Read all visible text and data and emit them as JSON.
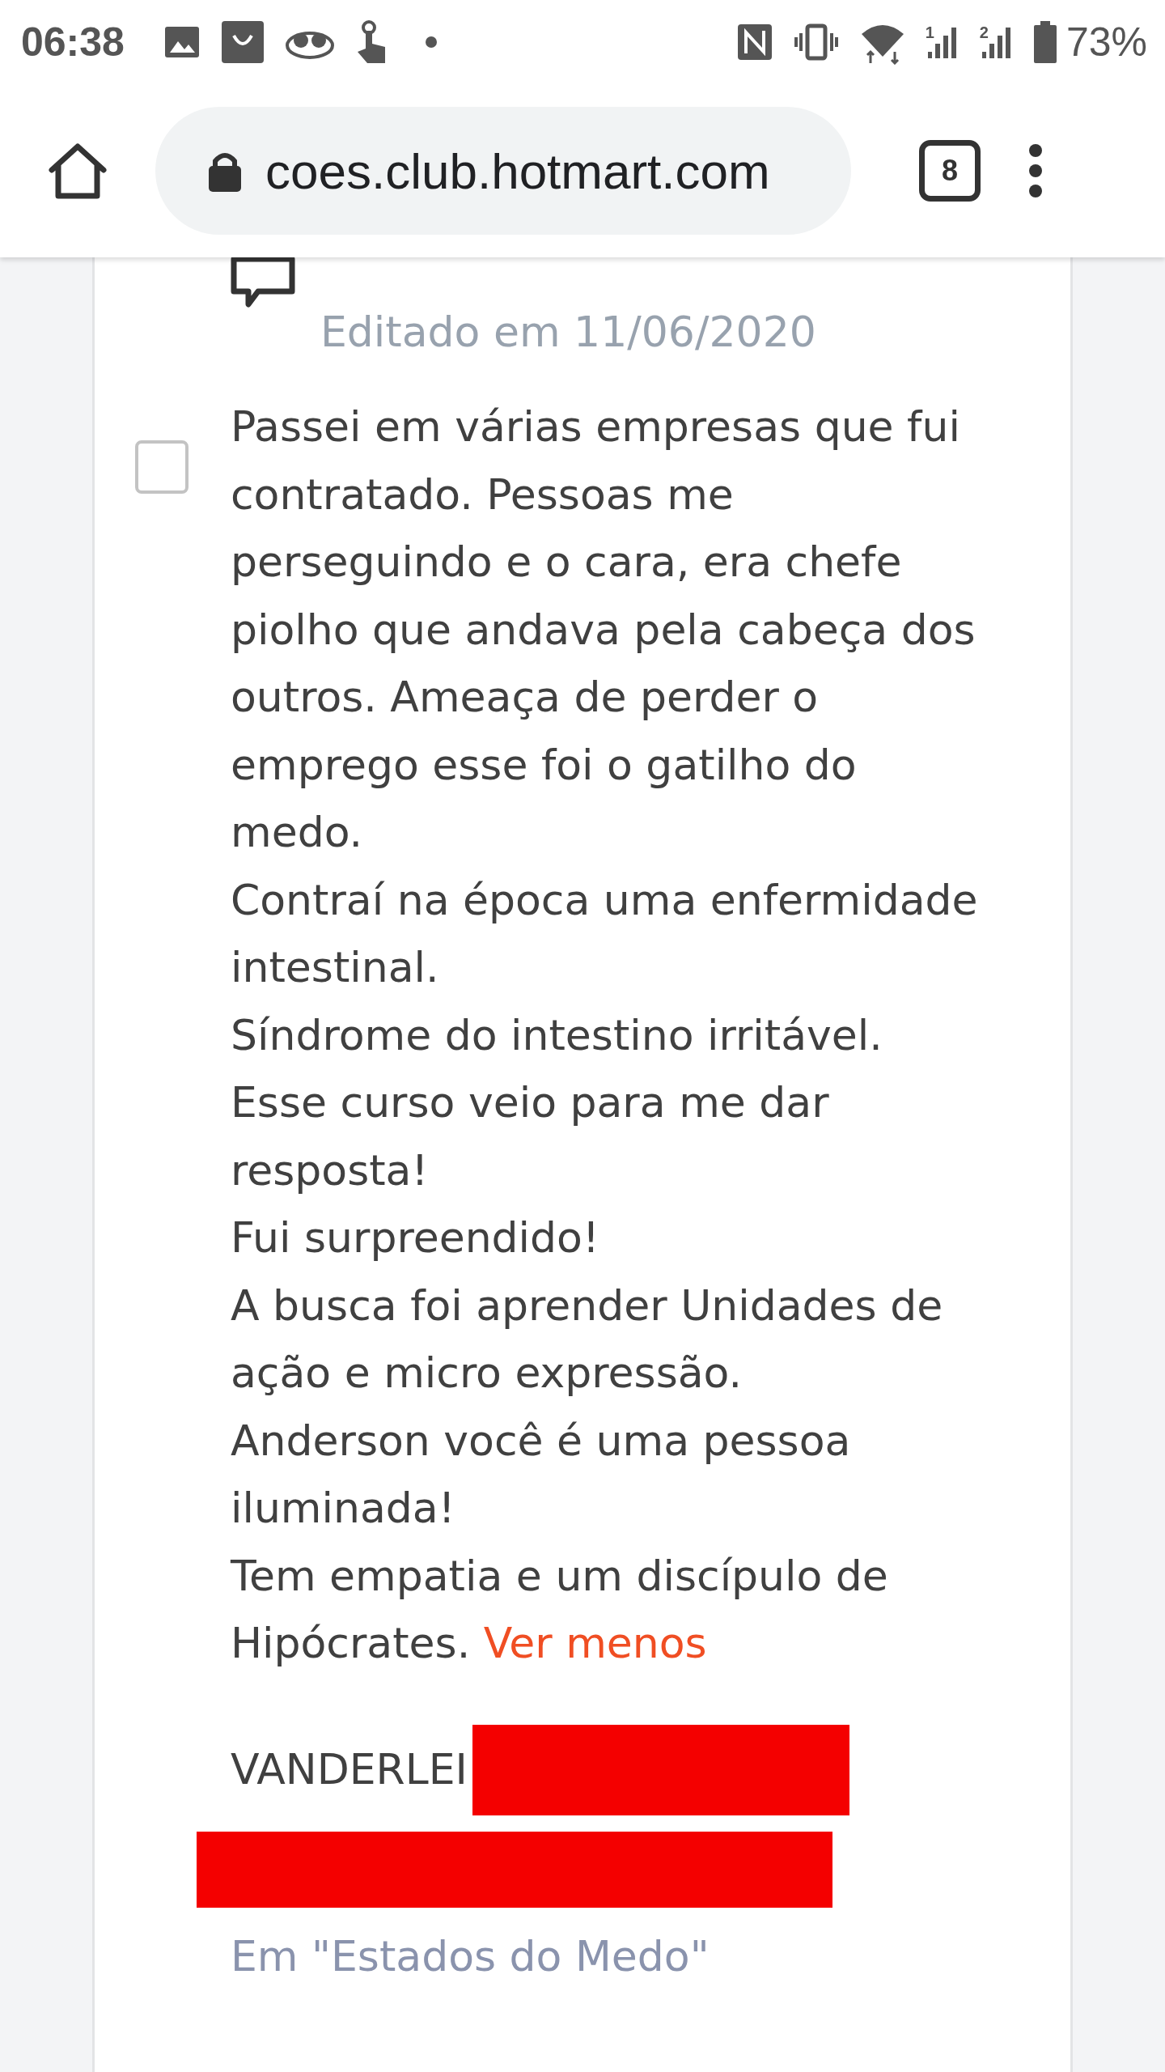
{
  "status_bar": {
    "time": "06:38",
    "battery": "73%",
    "sim_labels": [
      "1",
      "2"
    ]
  },
  "browser": {
    "url": "coes.club.hotmart.com",
    "tab_count": "8"
  },
  "post": {
    "edited": "Editado em 11/06/2020",
    "checked": false,
    "paragraphs": [
      "Passei em várias empresas que fui contratado. Pessoas me perseguindo e o cara, era chefe piolho que andava pela cabeça dos outros. Ameaça de perder o emprego esse foi o gatilho do medo.",
      "Contraí na época uma enfermidade intestinal.",
      "Síndrome do intestino irritável.",
      "Esse curso veio para me dar resposta!",
      "Fui surpreendido!",
      "A busca foi aprender Unidades de ação e micro expressão.",
      "Anderson você é uma pessoa iluminada!",
      "Tem empatia e um discípulo de Hipócrates."
    ],
    "toggle_link": "Ver menos",
    "author": "VANDERLEI",
    "location": "Em \"Estados do Medo\""
  }
}
